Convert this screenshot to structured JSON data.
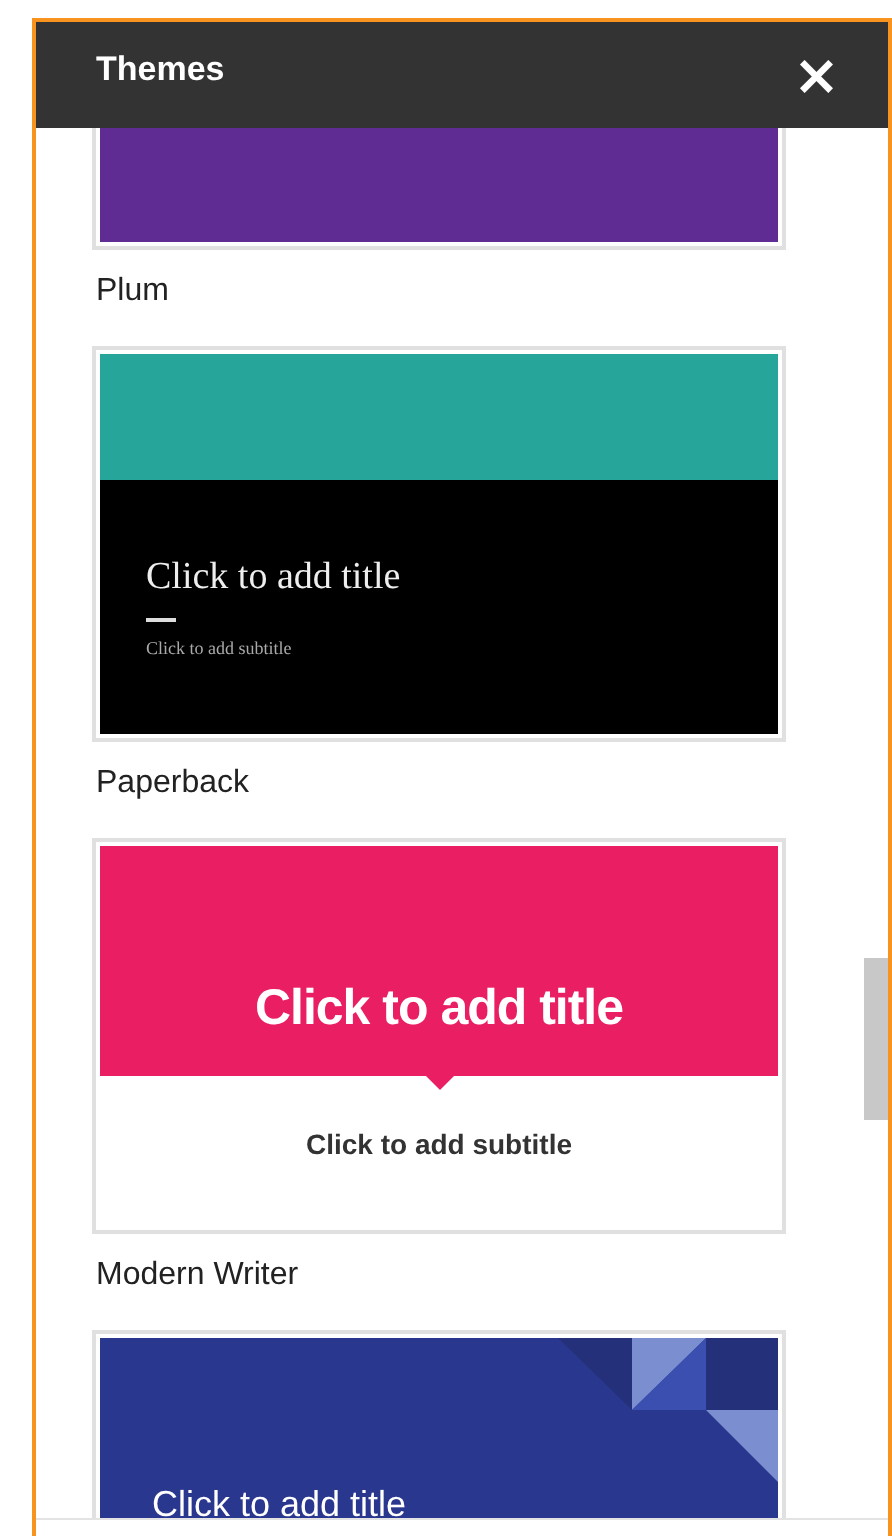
{
  "panel": {
    "title": "Themes",
    "close": "×"
  },
  "themes": [
    {
      "kind": "plum",
      "name": "Plum"
    },
    {
      "kind": "paperback",
      "name": "Paperback",
      "title": "Click to add title",
      "subtitle": "Click to add subtitle"
    },
    {
      "kind": "modern_writer",
      "name": "Modern Writer",
      "title": "Click to add title",
      "subtitle": "Click to add subtitle"
    },
    {
      "kind": "geometric",
      "title": "Click to add title"
    }
  ]
}
